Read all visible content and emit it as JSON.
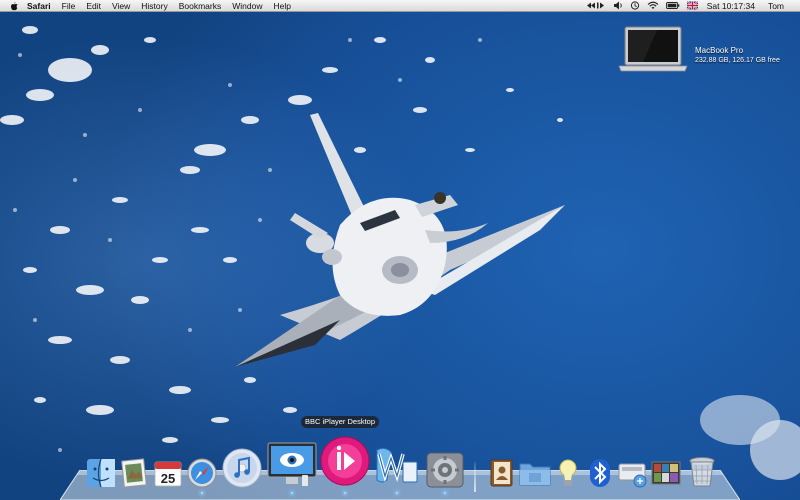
{
  "menubar": {
    "app_name": "Safari",
    "menus": [
      "File",
      "Edit",
      "View",
      "History",
      "Bookmarks",
      "Window",
      "Help"
    ],
    "clock": "Sat 10:17:34",
    "user": "Tom",
    "status_icons": [
      "media-controls-icon",
      "volume-icon",
      "time-machine-icon",
      "wifi-icon",
      "battery-icon",
      "uk-flag-icon"
    ]
  },
  "desktop": {
    "disk_name": "MacBook Pro",
    "disk_info": "232.88 GB, 126.17 GB free"
  },
  "dock": {
    "tooltip": "BBC iPlayer Desktop",
    "calendar_day": "25",
    "items": [
      "finder-icon",
      "preview-icon",
      "ical-icon",
      "safari-icon",
      "itunes-icon",
      "iphoto-icon",
      "bbc-iplayer-icon",
      "word-icon",
      "system-preferences-icon",
      "address-book-icon",
      "documents-folder-icon",
      "lightbulb-icon",
      "bluetooth-icon",
      "network-icon",
      "photo-stack-icon",
      "trash-icon"
    ]
  },
  "colors": {
    "sky": "#1a5aa5",
    "menubar": "#e8e8e8",
    "iplayer": "#e0197d"
  }
}
